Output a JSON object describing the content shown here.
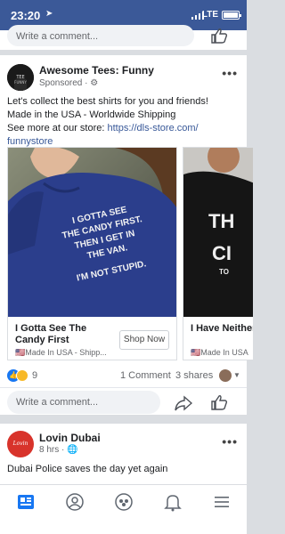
{
  "status": {
    "time": "23:20",
    "network": "LTE"
  },
  "top_comment_placeholder": "Write a comment...",
  "post1": {
    "author": "Awesome Tees: Funny",
    "meta": "Sponsored · ",
    "text_lines": [
      "Let's collect the best shirts for you and friends!",
      "Made in the USA - Worldwide Shipping"
    ],
    "link_prefix": "See more at our store: ",
    "link": "https://dls-store.com/",
    "link_line2": "funnystore",
    "cards": [
      {
        "title": "I Gotta See The Candy First",
        "subtitle": "🇺🇸Made In USA - Shipp...",
        "button": "Shop Now",
        "shirt_lines": [
          "I GOTTA SEE",
          "THE CANDY FIRST.",
          "THEN I GET IN",
          "THE VAN.",
          "I'M NOT STUPID."
        ]
      },
      {
        "title": "I Have Neither Time",
        "subtitle": "🇺🇸Made In USA",
        "shirt_text": "TH CI TO"
      }
    ],
    "reaction_count": "9",
    "comments": "1 Comment",
    "shares": "3 shares",
    "comment_placeholder": "Write a comment..."
  },
  "post2": {
    "author": "Lovin Dubai",
    "meta": "8 hrs · ",
    "logo_text": "Lovin Dubai",
    "text": "Dubai Police saves the day yet again"
  },
  "tabs": [
    "news-feed",
    "profile",
    "groups",
    "notifications",
    "menu"
  ],
  "colors": {
    "brand": "#3b5998",
    "link": "#385898",
    "accent": "#1877f2"
  }
}
